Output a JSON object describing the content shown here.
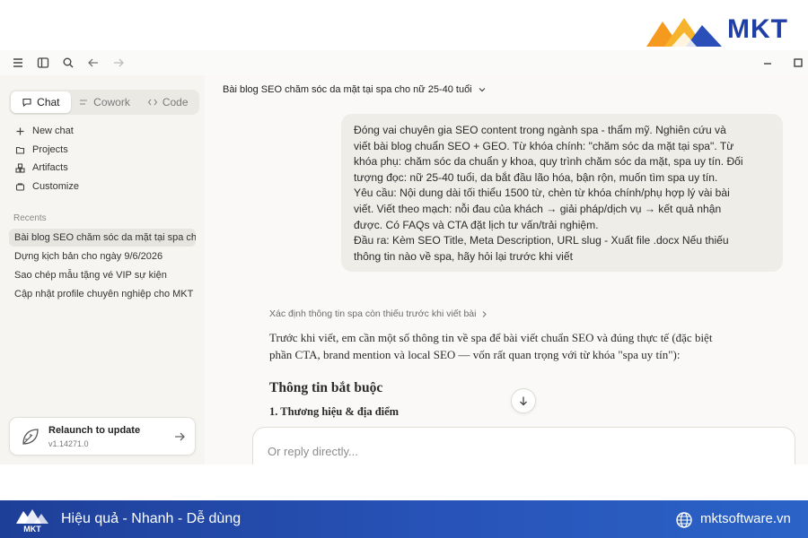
{
  "brand": {
    "logo_text": "MKT",
    "colors": {
      "orange": "#f59a1e",
      "blue": "#1f3fa6"
    }
  },
  "topbar": {
    "icons": [
      "menu-icon",
      "sidebar-toggle-icon",
      "search-icon",
      "back-arrow-icon",
      "forward-arrow-icon"
    ],
    "window_controls": [
      "minimize-icon",
      "maximize-icon"
    ]
  },
  "sidebar": {
    "modes": [
      {
        "label": "Chat",
        "active": true,
        "icon": "chat-bubble-icon"
      },
      {
        "label": "Cowork",
        "active": false,
        "icon": "cowork-icon"
      },
      {
        "label": "Code",
        "active": false,
        "icon": "code-icon"
      }
    ],
    "nav": [
      {
        "label": "New chat",
        "icon": "plus-icon"
      },
      {
        "label": "Projects",
        "icon": "projects-icon"
      },
      {
        "label": "Artifacts",
        "icon": "artifacts-icon"
      },
      {
        "label": "Customize",
        "icon": "customize-icon"
      }
    ],
    "recents_label": "Recents",
    "recents": [
      {
        "label": "Bài blog SEO chăm sóc da mặt tại spa cho",
        "active": true
      },
      {
        "label": "Dựng kịch bản cho ngày 9/6/2026",
        "active": false
      },
      {
        "label": "Sao chép mẫu tặng vé VIP sự kiện",
        "active": false
      },
      {
        "label": "Cập nhật profile chuyên nghiệp cho MKT",
        "active": false
      }
    ],
    "update_card": {
      "title": "Relaunch to update",
      "version": "v1.14271.0"
    }
  },
  "conversation": {
    "title": "Bài blog SEO chăm sóc da mặt tại spa cho nữ 25-40 tuổi",
    "user_message": {
      "lines": [
        "Đóng vai chuyên gia SEO content trong ngành spa - thẩm mỹ. Nghiên cứu và",
        "viết bài blog chuẩn SEO + GEO. Từ khóa chính: \"chăm sóc da mặt tại spa\". Từ",
        "khóa phụ: chăm sóc da chuẩn y khoa, quy trình chăm sóc da mặt, spa uy tín. Đối",
        "tượng đọc: nữ 25-40 tuổi, da bắt đầu lão hóa, bận rộn, muốn tìm spa uy tín.",
        "Yêu cầu: Nội dung dài tối thiểu 1500 từ, chèn từ khóa chính/phụ hợp lý vài bài",
        "viết. Viết theo mạch: nỗi đau của khách → giải pháp/dịch vụ → kết quả nhận",
        "được. Có FAQs và CTA đặt lịch tư vấn/trải nghiệm.",
        "Đầu ra: Kèm SEO Title, Meta Description, URL slug - Xuất file .docx Nếu thiếu",
        "thông tin nào về spa, hãy hỏi lại trước khi viết"
      ]
    },
    "thinking_label": "Xác định thông tin spa còn thiếu trước khi viết bài",
    "assistant_reply": {
      "para_lines": [
        "Trước khi viết, em cần một số thông tin về spa để bài viết chuẩn SEO và đúng thực tế (đặc biệt",
        "phần CTA, brand mention và local SEO — vốn rất quan trọng với từ khóa \"spa uy tín\"):"
      ],
      "heading": "Thông tin bắt buộc",
      "subheading": "1. Thương hiệu & địa điểm"
    },
    "reply_placeholder": "Or reply directly..."
  },
  "footer": {
    "slogan": "Hiệu quả - Nhanh - Dễ dùng",
    "website": "mktsoftware.vn",
    "logo_text": "MKT"
  }
}
